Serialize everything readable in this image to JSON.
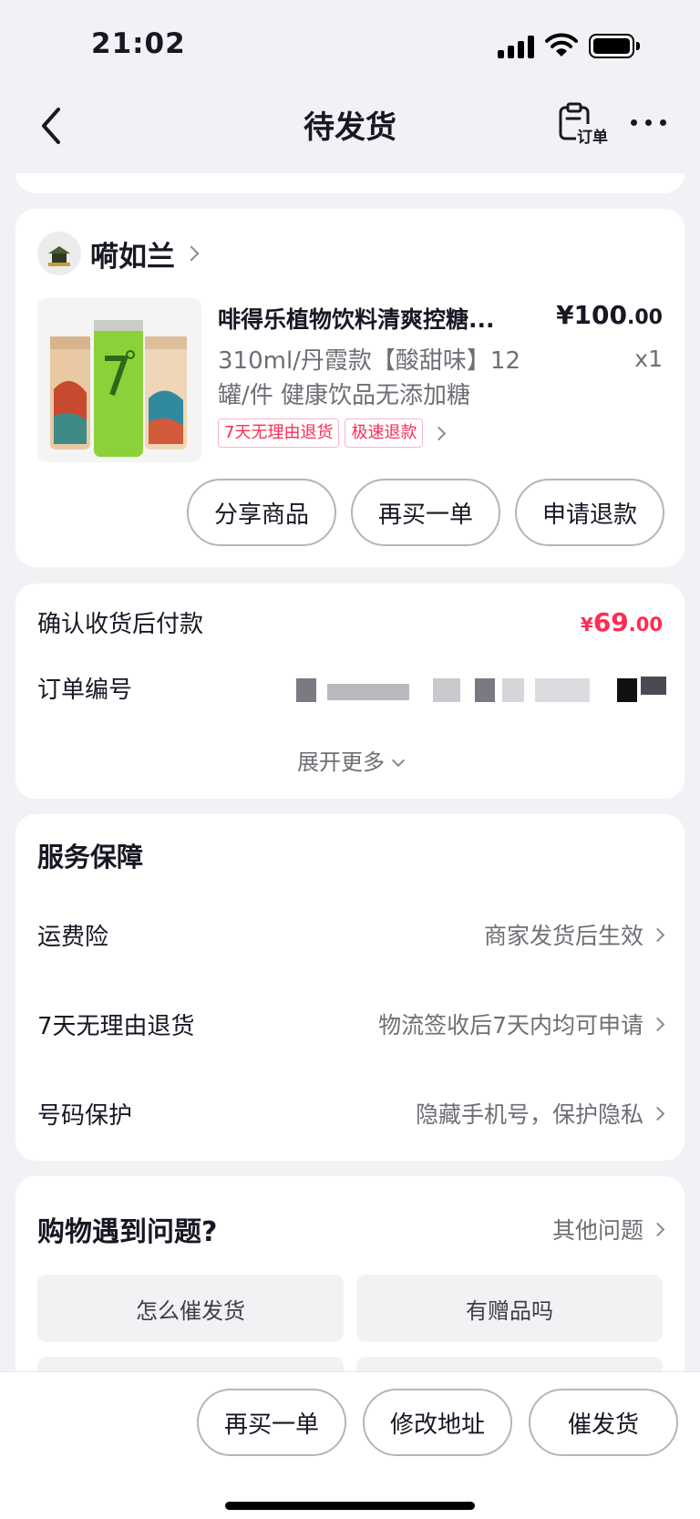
{
  "status_bar": {
    "time": "21:02"
  },
  "nav": {
    "title": "待发货",
    "order_label": "订单"
  },
  "shop": {
    "name": "嗬如兰"
  },
  "product": {
    "title": "啡得乐植物饮料清爽控糖...",
    "price_main": "¥100",
    "price_decimal": ".00",
    "spec": "310ml/丹霞款【酸甜味】12罐/件 健康饮品无添加糖",
    "quantity": "x1",
    "tags": [
      "7天无理由退货",
      "极速退款"
    ]
  },
  "product_actions": [
    "分享商品",
    "再买一单",
    "申请退款"
  ],
  "payment": {
    "label": "确认收货后付款",
    "currency": "¥",
    "amount_main": "69",
    "amount_decimal": ".00",
    "order_no_label": "订单编号",
    "expand_label": "展开更多"
  },
  "services": {
    "title": "服务保障",
    "items": [
      {
        "name": "运费险",
        "desc": "商家发货后生效"
      },
      {
        "name": "7天无理由退货",
        "desc": "物流签收后7天内均可申请"
      },
      {
        "name": "号码保护",
        "desc": "隐藏手机号，保护隐私"
      }
    ]
  },
  "help": {
    "title": "购物遇到问题?",
    "other_label": "其他问题",
    "questions": [
      "怎么催发货",
      "有赠品吗"
    ]
  },
  "bottom_actions": [
    "再买一单",
    "修改地址",
    "催发货"
  ],
  "colors": {
    "accent": "#fe2c55",
    "background": "#f2f2f6"
  }
}
